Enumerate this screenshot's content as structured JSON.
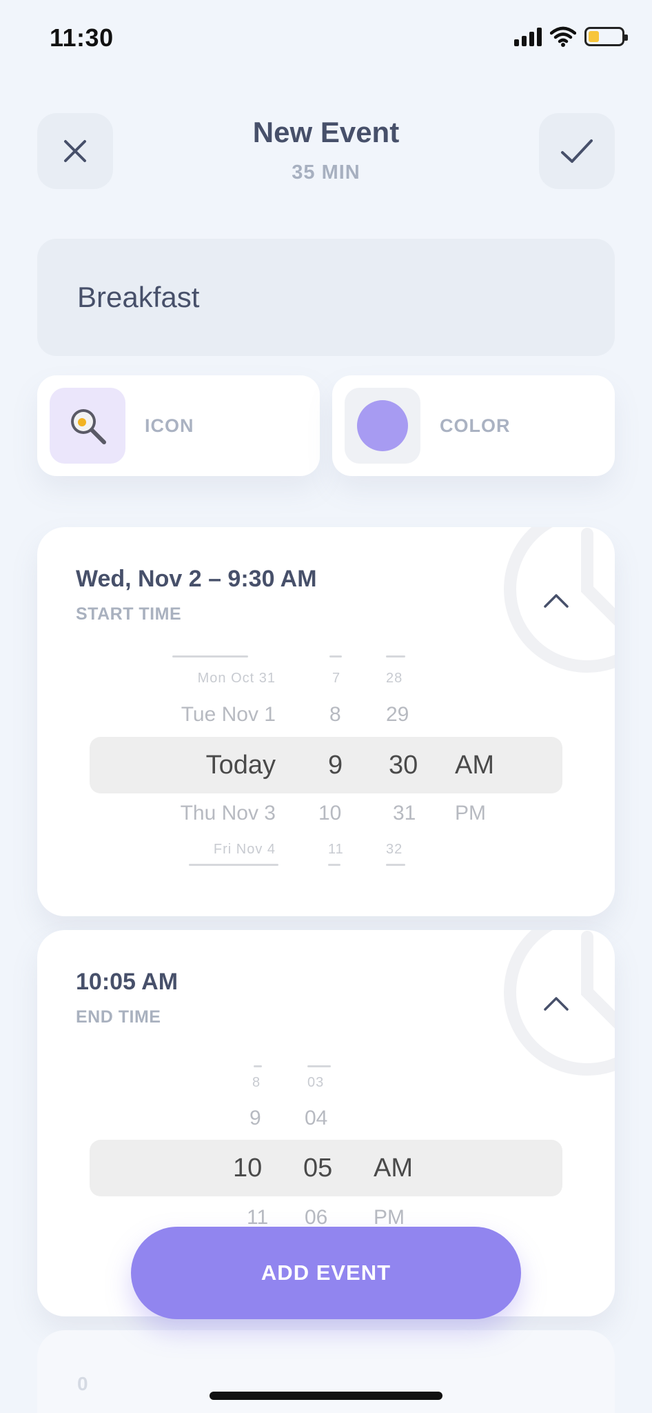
{
  "status_bar": {
    "time": "11:30"
  },
  "header": {
    "title": "New Event",
    "duration": "35 MIN"
  },
  "event": {
    "name": "Breakfast"
  },
  "options": {
    "icon_label": "ICON",
    "color_label": "COLOR",
    "selected_color": "#a79bf2",
    "icon_swatch_bg": "#ebe6fb"
  },
  "start": {
    "title": "Wed, Nov 2 – 9:30 AM",
    "label": "START TIME",
    "picker": {
      "dates": [
        "Mon Oct 31",
        "Tue Nov 1",
        "Today",
        "Thu Nov 3",
        "Fri Nov 4"
      ],
      "hours": [
        "7",
        "8",
        "9",
        "10",
        "11"
      ],
      "minutes": [
        "28",
        "29",
        "30",
        "31",
        "32"
      ],
      "periods": [
        "AM",
        "PM"
      ]
    }
  },
  "end": {
    "title": "10:05 AM",
    "label": "END TIME",
    "picker": {
      "hours": [
        "8",
        "9",
        "10",
        "11"
      ],
      "minutes": [
        "03",
        "04",
        "05",
        "06"
      ],
      "periods": [
        "AM",
        "PM"
      ]
    }
  },
  "actions": {
    "add_event": "ADD EVENT"
  },
  "peek": {
    "text": "0"
  },
  "colors": {
    "accent": "#9185ef",
    "text": "#47506a",
    "muted": "#a9b1bf",
    "background": "#f1f5fb"
  }
}
